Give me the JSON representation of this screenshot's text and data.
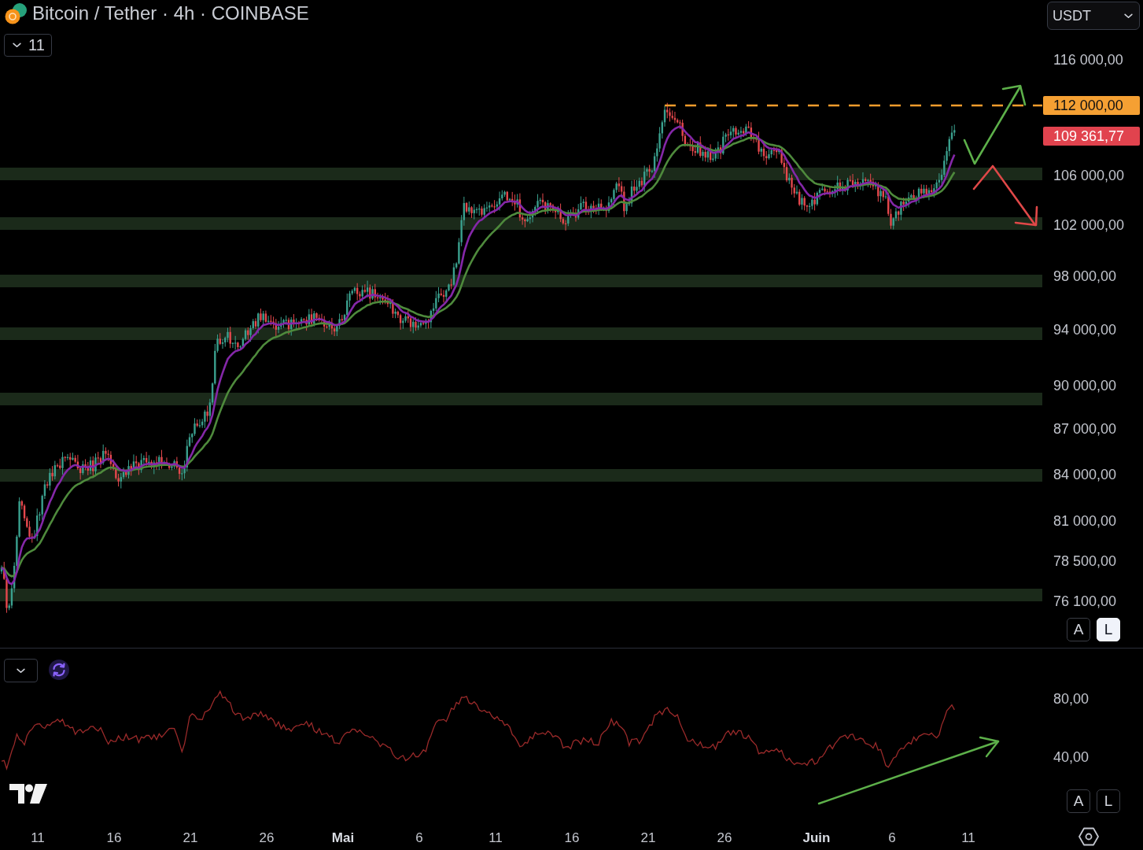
{
  "header": {
    "title": "Bitcoin / Tether · 4h · COINBASE",
    "indicators_button": "11",
    "currency": "USDT"
  },
  "price_axis": {
    "labels": [
      "116 000,00",
      "106 000,00",
      "102 000,00",
      "98 000,00",
      "94 000,00",
      "90 000,00",
      "87 000,00",
      "84 000,00",
      "81 000,00",
      "78 500,00",
      "76 100,00"
    ],
    "price_tags": [
      {
        "text": "112 000,00",
        "color": "#f5a033"
      },
      {
        "text": "109 361,77",
        "color": "#e1434e"
      }
    ],
    "scale_buttons": [
      {
        "label": "A",
        "on": false
      },
      {
        "label": "L",
        "on": true
      }
    ]
  },
  "rsi_pane": {
    "axis_labels": [
      "80,00",
      "40,00"
    ],
    "scale_buttons": [
      {
        "label": "A",
        "on": false
      },
      {
        "label": "L",
        "on": false
      }
    ]
  },
  "time_axis": {
    "labels": [
      {
        "text": "11",
        "kind": "day"
      },
      {
        "text": "16",
        "kind": "day"
      },
      {
        "text": "21",
        "kind": "day"
      },
      {
        "text": "26",
        "kind": "day"
      },
      {
        "text": "Mai",
        "kind": "month"
      },
      {
        "text": "6",
        "kind": "day"
      },
      {
        "text": "11",
        "kind": "day"
      },
      {
        "text": "16",
        "kind": "day"
      },
      {
        "text": "21",
        "kind": "day"
      },
      {
        "text": "26",
        "kind": "day"
      },
      {
        "text": "Juin",
        "kind": "month"
      },
      {
        "text": "6",
        "kind": "day"
      },
      {
        "text": "11",
        "kind": "day"
      }
    ]
  }
}
